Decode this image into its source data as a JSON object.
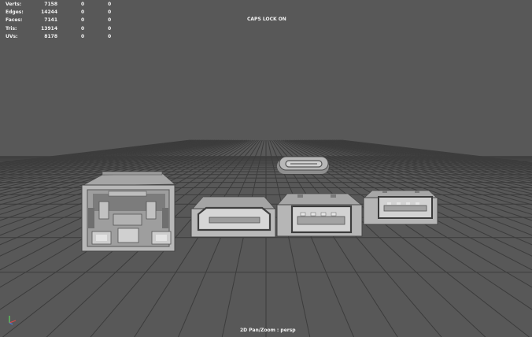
{
  "hud": {
    "rows": [
      {
        "label": "Verts:",
        "v1": "7158",
        "v2": "0",
        "v3": "0"
      },
      {
        "label": "Edges:",
        "v1": "14244",
        "v2": "0",
        "v3": "0"
      },
      {
        "label": "Faces:",
        "v1": "7141",
        "v2": "0",
        "v3": "0"
      },
      {
        "label": "Tris:",
        "v1": "13914",
        "v2": "0",
        "v3": "0"
      },
      {
        "label": "UVs:",
        "v1": "8178",
        "v2": "0",
        "v3": "0"
      }
    ]
  },
  "viewport": {
    "caps_message": "CAPS LOCK ON",
    "camera_label": "2D Pan/Zoom : persp",
    "background_color": "#585858",
    "grid_color": "#3a3a3a",
    "model_fill": "#bdbdbd",
    "model_shade": "#8f8f8f",
    "model_dark": "#3d3d3d"
  },
  "scene": {
    "objects": [
      {
        "name": "usb-c-connector"
      },
      {
        "name": "rj45-jack"
      },
      {
        "name": "hdmi-port"
      },
      {
        "name": "usb-a-port-large"
      },
      {
        "name": "usb-a-port-small"
      }
    ]
  },
  "axis_gizmo": {
    "x": "X",
    "y": "Y",
    "z": "Z"
  }
}
